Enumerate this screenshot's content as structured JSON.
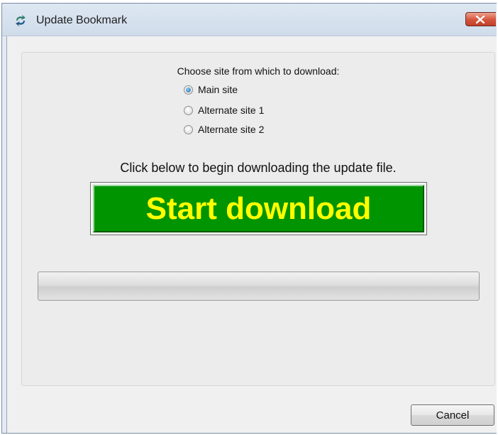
{
  "window": {
    "title": "Update Bookmark",
    "icon": "bookmark-update-icon",
    "close_icon": "close-icon"
  },
  "download": {
    "choose_label": "Choose site from which to download:",
    "sites": [
      {
        "label": "Main site",
        "selected": true
      },
      {
        "label": "Alternate site 1",
        "selected": false
      },
      {
        "label": "Alternate site 2",
        "selected": false
      }
    ],
    "instruction": "Click below to begin downloading the update file.",
    "start_label": "Start download",
    "progress": 0
  },
  "footer": {
    "cancel_label": "Cancel"
  },
  "colors": {
    "start_button_bg": "#009400",
    "start_button_text": "#ffff00",
    "close_button": "#c9432f"
  }
}
